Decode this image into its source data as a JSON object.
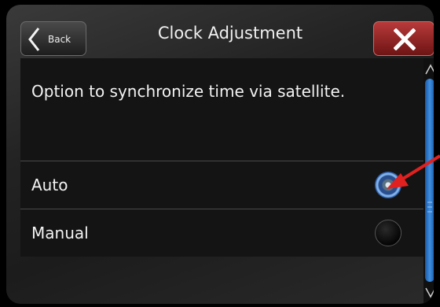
{
  "header": {
    "back_label": "Back",
    "title": "Clock Adjustment"
  },
  "content": {
    "description": "Option to synchronize time via satellite.",
    "options": [
      {
        "label": "Auto",
        "selected": true
      },
      {
        "label": "Manual",
        "selected": false
      }
    ]
  },
  "icons": {
    "back": "chevron-left-icon",
    "close": "close-x-icon",
    "scroll_up": "chevron-up-icon",
    "scroll_down": "chevron-down-icon",
    "annotation": "red-arrow-icon"
  },
  "colors": {
    "close_button": "#9b2626",
    "scroll_thumb": "#2f7fd6",
    "selected_radio": "#3a78c8",
    "annotation_arrow": "#e0211f"
  }
}
